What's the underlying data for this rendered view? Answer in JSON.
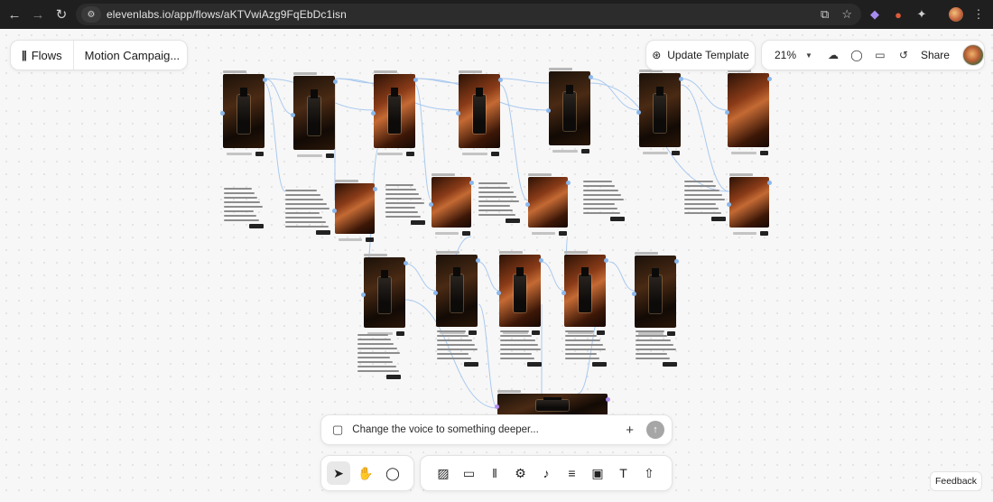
{
  "browser": {
    "url": "elevenlabs.io/app/flows/aKTVwiAzg9FqEbDc1isn",
    "icons": [
      "back-arrow-icon",
      "forward-arrow-icon",
      "reload-icon",
      "site-info-icon",
      "install-app-icon",
      "star-icon",
      "extension-icon",
      "puzzle-icon",
      "profile-icon",
      "kebab-menu-icon"
    ]
  },
  "header": {
    "flows_label": "Flows",
    "project_title": "Motion Campaig...",
    "update_template_label": "Update Template",
    "zoom_level": "21%",
    "share_label": "Share"
  },
  "chat": {
    "value": "Change the voice to something deeper..."
  },
  "toolbar": {
    "left_tools": [
      "select-tool",
      "hand-tool",
      "comment-tool"
    ],
    "right_tools": [
      "image-tool",
      "video-tool",
      "audio-tool",
      "settings-tool",
      "music-tool",
      "text-to-speech-tool",
      "upscale-tool",
      "text-tool",
      "upload-tool"
    ]
  },
  "feedback_label": "Feedback",
  "colors": {
    "accent_port": "#8bb8ec",
    "accent_port_purple": "#b48ef0",
    "canvas_bg": "#f7f7f7"
  }
}
